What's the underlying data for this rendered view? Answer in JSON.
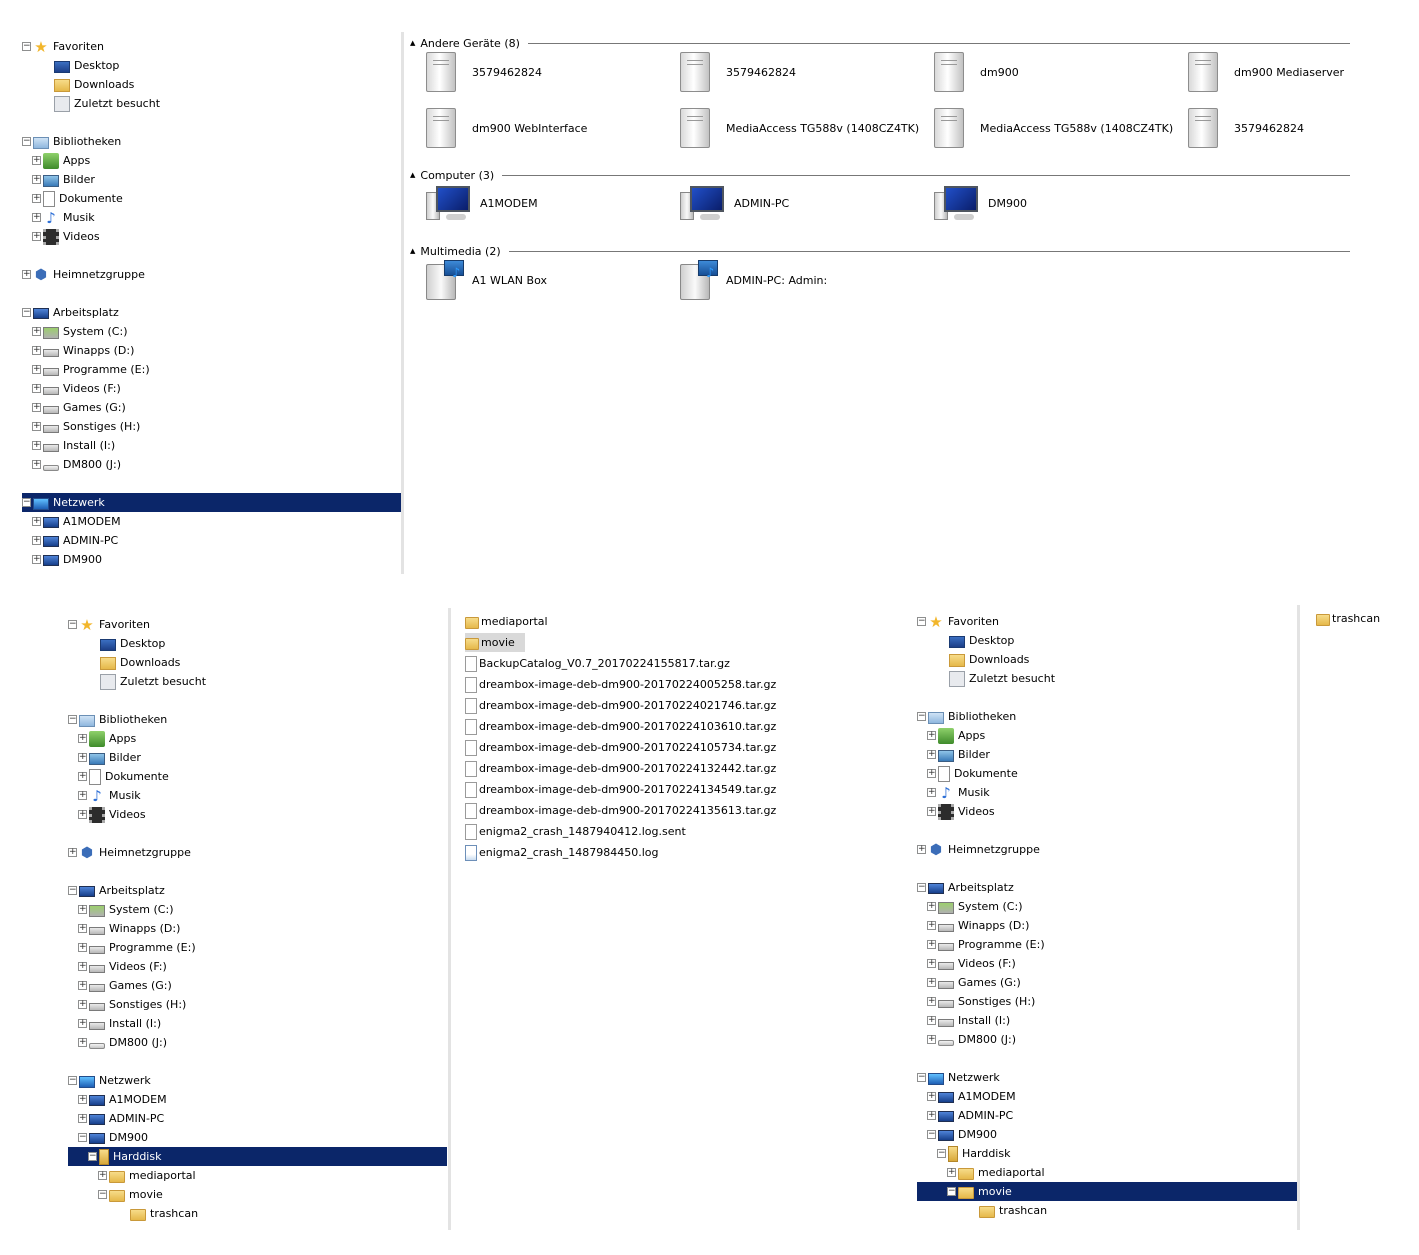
{
  "nav": {
    "favorites": "Favoriten",
    "desktop": "Desktop",
    "downloads": "Downloads",
    "recent": "Zuletzt besucht",
    "libraries": "Bibliotheken",
    "apps": "Apps",
    "pictures": "Bilder",
    "documents": "Dokumente",
    "music": "Musik",
    "videos": "Videos",
    "homegroup": "Heimnetzgruppe",
    "computer": "Arbeitsplatz",
    "drives": [
      "System (C:)",
      "Winapps (D:)",
      "Programme (E:)",
      "Videos (F:)",
      "Games (G:)",
      "Sonstiges (H:)",
      "Install (I:)",
      "DM800 (J:)"
    ],
    "network": "Netzwerk",
    "hosts": [
      "A1MODEM",
      "ADMIN-PC",
      "DM900"
    ],
    "harddisk": "Harddisk",
    "mediaportal": "mediaportal",
    "movie": "movie",
    "trashcan": "trashcan"
  },
  "network_view": {
    "groups": [
      {
        "title": "Andere Geräte (8)",
        "items": [
          "3579462824",
          "3579462824",
          "dm900",
          "dm900 Mediaserver",
          "dm900 WebInterface",
          "MediaAccess TG588v (1408CZ4TK)",
          "MediaAccess TG588v (1408CZ4TK)",
          "3579462824"
        ]
      },
      {
        "title": "Computer (3)",
        "items": [
          "A1MODEM",
          "ADMIN-PC",
          "DM900"
        ]
      },
      {
        "title": "Multimedia (2)",
        "items": [
          "A1 WLAN Box",
          "ADMIN-PC: Admin:"
        ]
      }
    ]
  },
  "harddisk_files": [
    {
      "name": "mediaportal",
      "type": "folder"
    },
    {
      "name": "movie",
      "type": "folder"
    },
    {
      "name": "BackupCatalog_V0.7_20170224155817.tar.gz",
      "type": "file"
    },
    {
      "name": "dreambox-image-deb-dm900-20170224005258.tar.gz",
      "type": "file"
    },
    {
      "name": "dreambox-image-deb-dm900-20170224021746.tar.gz",
      "type": "file"
    },
    {
      "name": "dreambox-image-deb-dm900-20170224103610.tar.gz",
      "type": "file"
    },
    {
      "name": "dreambox-image-deb-dm900-20170224105734.tar.gz",
      "type": "file"
    },
    {
      "name": "dreambox-image-deb-dm900-20170224132442.tar.gz",
      "type": "file"
    },
    {
      "name": "dreambox-image-deb-dm900-20170224134549.tar.gz",
      "type": "file"
    },
    {
      "name": "dreambox-image-deb-dm900-20170224135613.tar.gz",
      "type": "file"
    },
    {
      "name": "enigma2_crash_1487940412.log.sent",
      "type": "file"
    },
    {
      "name": "enigma2_crash_1487984450.log",
      "type": "log"
    }
  ],
  "movie_files": [
    {
      "name": "trashcan",
      "type": "folder"
    }
  ]
}
